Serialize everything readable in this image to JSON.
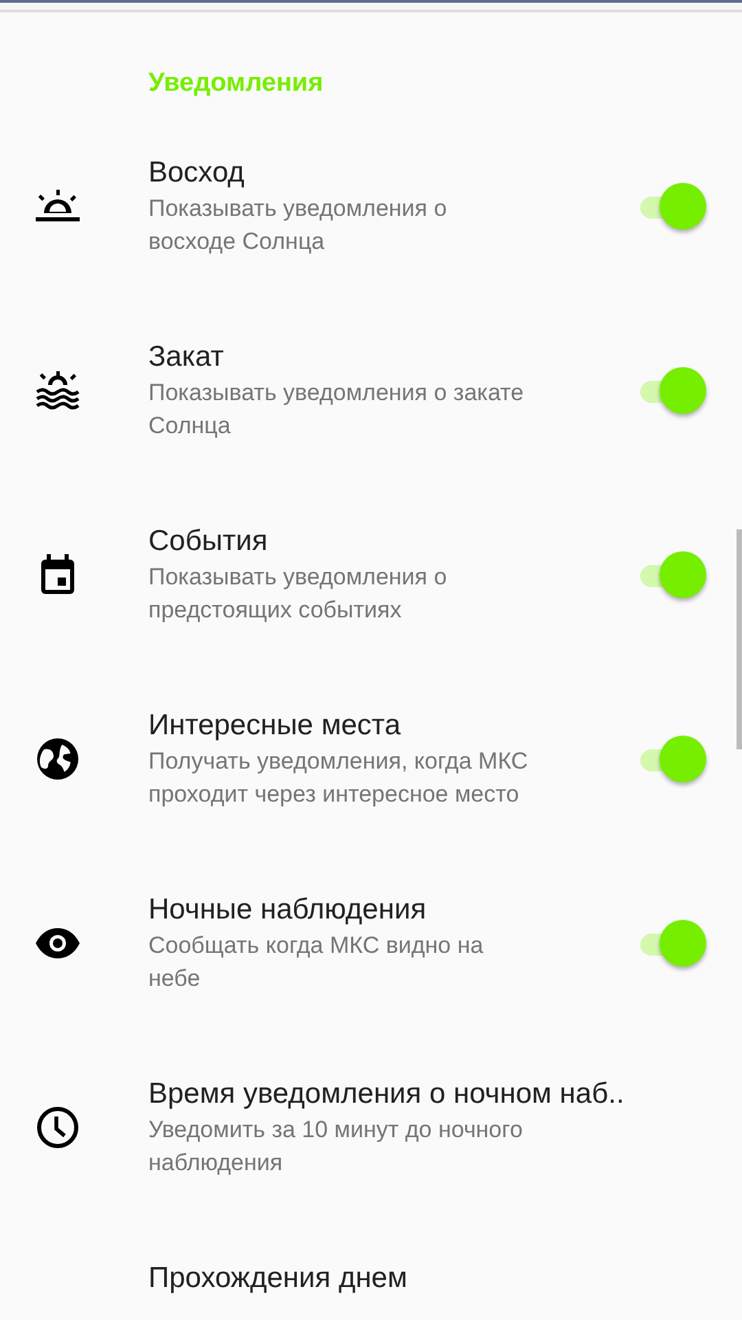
{
  "section_title": "Уведомления",
  "items": [
    {
      "title": "Восход",
      "subtitle": "Показывать уведомления о восходе Солнца",
      "kind": "switch",
      "on": true
    },
    {
      "title": "Закат",
      "subtitle": "Показывать уведомления о закате Солнца",
      "kind": "switch",
      "on": true
    },
    {
      "title": "События",
      "subtitle": "Показывать уведомления о предстоящих событиях",
      "kind": "switch",
      "on": true
    },
    {
      "title": "Интересные места",
      "subtitle": "Получать уведомления, когда МКС проходит через интересное место",
      "kind": "switch",
      "on": true
    },
    {
      "title": "Ночные наблюдения",
      "subtitle": "Сообщать когда МКС видно на небе",
      "kind": "switch",
      "on": true
    },
    {
      "title": "Время уведомления о ночном наб..",
      "subtitle": "Уведомить за 10 минут до ночного наблюдения",
      "kind": "plain"
    },
    {
      "title": "Прохождения днем",
      "kind": "plain"
    }
  ]
}
